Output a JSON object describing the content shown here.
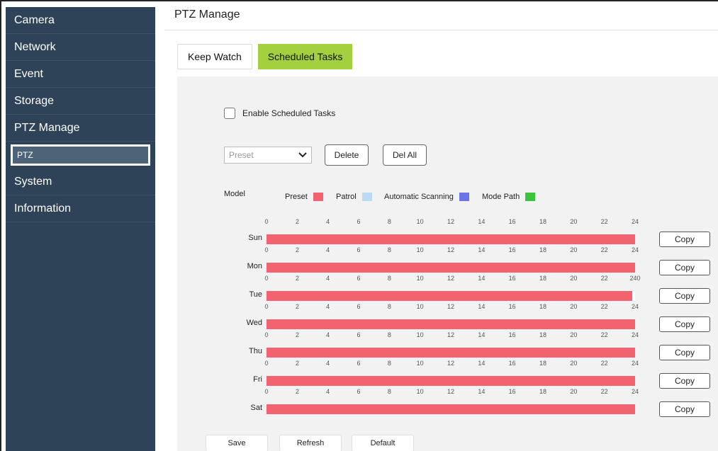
{
  "sidebar": {
    "items": [
      {
        "label": "Camera"
      },
      {
        "label": "Network"
      },
      {
        "label": "Event"
      },
      {
        "label": "Storage"
      },
      {
        "label": "PTZ Manage"
      },
      {
        "label": "PTZ"
      },
      {
        "label": "System"
      },
      {
        "label": "Information"
      }
    ]
  },
  "page": {
    "title": "PTZ Manage",
    "tabs": [
      {
        "label": "Keep Watch"
      },
      {
        "label": "Scheduled Tasks"
      }
    ]
  },
  "panel": {
    "enable_label": "Enable Scheduled Tasks",
    "preset_select": {
      "value": "Preset",
      "options": [
        "Preset"
      ]
    },
    "delete_label": "Delete",
    "delall_label": "Del All",
    "legend": {
      "model_label": "Model",
      "items": [
        {
          "label": "Preset",
          "color": "#f1646f"
        },
        {
          "label": "Patrol",
          "color": "#b9dcf3"
        },
        {
          "label": "Automatic Scanning",
          "color": "#6b73e6"
        },
        {
          "label": "Mode Path",
          "color": "#3cc43c"
        }
      ]
    },
    "hours": [
      "0",
      "2",
      "4",
      "6",
      "8",
      "10",
      "12",
      "14",
      "16",
      "18",
      "20",
      "22",
      "24"
    ],
    "tue_hours": [
      "0",
      "2",
      "4",
      "6",
      "8",
      "10",
      "12",
      "14",
      "16",
      "18",
      "20",
      "22",
      "240"
    ],
    "days": [
      {
        "label": "Sun",
        "copy": "Copy"
      },
      {
        "label": "Mon",
        "copy": "Copy"
      },
      {
        "label": "Tue",
        "copy": "Copy"
      },
      {
        "label": "Wed",
        "copy": "Copy"
      },
      {
        "label": "Thu",
        "copy": "Copy"
      },
      {
        "label": "Fri",
        "copy": "Copy"
      },
      {
        "label": "Sat",
        "copy": "Copy"
      }
    ],
    "save_label": "Save",
    "refresh_label": "Refresh",
    "default_label": "Default"
  }
}
